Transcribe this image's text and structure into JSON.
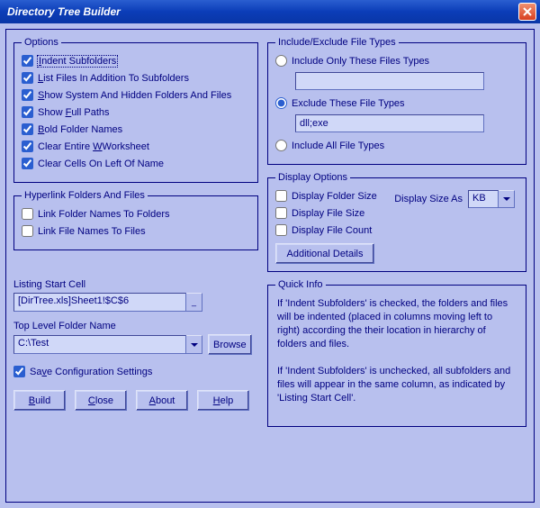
{
  "window": {
    "title": "Directory Tree Builder"
  },
  "options": {
    "legend": "Options",
    "indent_subfolders": {
      "label": "Indent Subfolders",
      "checked": true
    },
    "list_files": {
      "label": "List Files In Addition To Subfolders",
      "checked": true
    },
    "show_system": {
      "label": "Show System And Hidden Folders And Files",
      "checked": true
    },
    "show_full_paths": {
      "label": "Show Full Paths",
      "checked": true
    },
    "bold_folder": {
      "label": "Bold Folder Names",
      "checked": true
    },
    "clear_worksheet": {
      "label": "Clear Entire Worksheet",
      "checked": true
    },
    "clear_cells_left": {
      "label": "Clear Cells On Left Of Name",
      "checked": true
    }
  },
  "hyperlink": {
    "legend": "Hyperlink Folders And Files",
    "link_folders": {
      "label": "Link Folder Names To Folders",
      "checked": false
    },
    "link_files": {
      "label": "Link File Names To Files",
      "checked": false
    }
  },
  "include_exclude": {
    "legend": "Include/Exclude File Types",
    "include_only": {
      "label": "Include Only These Files Types",
      "value": ""
    },
    "exclude": {
      "label": "Exclude These File Types",
      "value": "dll;exe"
    },
    "include_all": {
      "label": "Include All File Types"
    },
    "selected": "exclude"
  },
  "display": {
    "legend": "Display Options",
    "folder_size": {
      "label": "Display Folder Size",
      "checked": false
    },
    "file_size": {
      "label": "Display File Size",
      "checked": false
    },
    "file_count": {
      "label": "Display File Count",
      "checked": false
    },
    "size_as_label": "Display Size As",
    "size_as_value": "KB",
    "additional_btn": "Additional Details"
  },
  "listing": {
    "start_cell_label": "Listing Start Cell",
    "start_cell_value": "[DirTree.xls]Sheet1!$C$6",
    "top_folder_label": "Top Level Folder Name",
    "top_folder_value": "C:\\Test",
    "browse_btn": "Browse",
    "save_config": {
      "label": "Save Configuration Settings",
      "checked": true
    }
  },
  "buttons": {
    "build": "Build",
    "close": "Close",
    "about": "About",
    "help": "Help"
  },
  "quick_info": {
    "legend": "Quick Info",
    "p1": "If 'Indent Subfolders' is checked, the folders and files will be indented (placed in columns moving left to right) according the their location in hierarchy of folders and files.",
    "p2": "If 'Indent Subfolders' is unchecked, all subfolders  and files will appear in the same column, as indicated by 'Listing Start Cell'."
  }
}
